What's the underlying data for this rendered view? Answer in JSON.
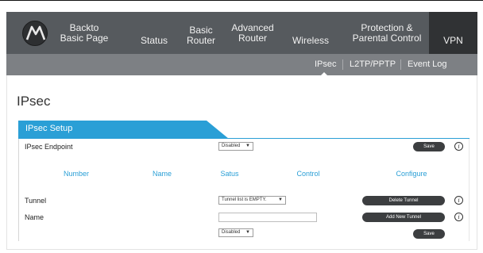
{
  "nav": {
    "items": [
      {
        "label": "Backto\nBasic Page"
      },
      {
        "label": "Status"
      },
      {
        "label": "Basic\nRouter"
      },
      {
        "label": "Advanced\nRouter"
      },
      {
        "label": "Wireless"
      },
      {
        "label": "Protection &\nParental Control"
      },
      {
        "label": "VPN",
        "active": true
      }
    ]
  },
  "subnav": {
    "items": [
      {
        "label": "IPsec",
        "active": true
      },
      {
        "label": "L2TP/PPTP"
      },
      {
        "label": "Event Log"
      }
    ]
  },
  "page": {
    "title": "IPsec"
  },
  "section": {
    "title": "IPsec Setup",
    "endpoint_label": "IPsec Endpoint",
    "endpoint_value": "Disabled",
    "save_label": "Save",
    "columns": [
      "Number",
      "Name",
      "Satus",
      "Control",
      "Configure"
    ],
    "tunnel_label": "Tunnel",
    "tunnel_value": "Tunnel list is EMPTY.",
    "delete_label": "Delete Tunnel",
    "name_label": "Name",
    "name_value": "",
    "add_label": "Add New Tunnel",
    "state_value": "Disabled",
    "save2_label": "Save",
    "info_glyph": "i"
  },
  "colors": {
    "accent": "#2a9fd6",
    "nav_bg": "#565a5e",
    "nav_active": "#303234",
    "subnav_bg": "#7d8084",
    "button": "#3c3e40"
  }
}
